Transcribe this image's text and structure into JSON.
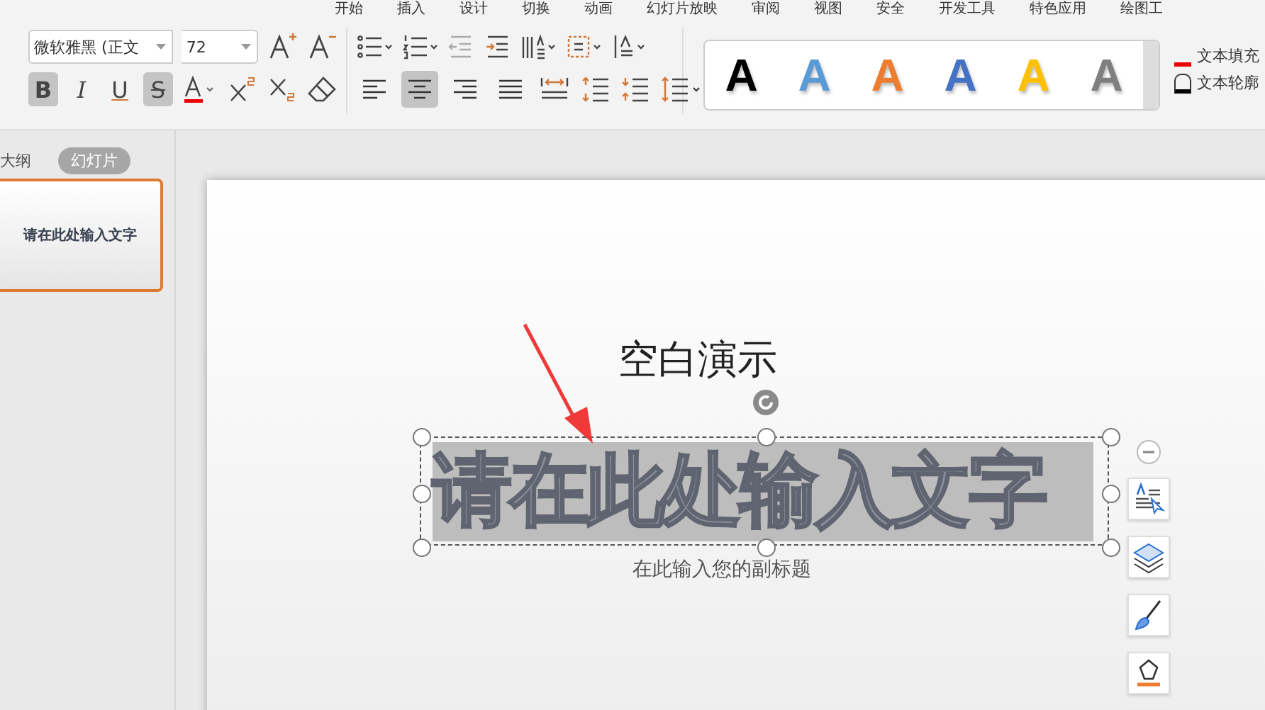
{
  "menu_tabs": [
    {
      "label": "开始",
      "selected": false
    },
    {
      "label": "插入",
      "selected": false
    },
    {
      "label": "设计",
      "selected": false
    },
    {
      "label": "切换",
      "selected": false
    },
    {
      "label": "动画",
      "selected": false
    },
    {
      "label": "幻灯片放映",
      "selected": false
    },
    {
      "label": "审阅",
      "selected": false
    },
    {
      "label": "视图",
      "selected": false
    },
    {
      "label": "安全",
      "selected": false
    },
    {
      "label": "开发工具",
      "selected": false
    },
    {
      "label": "特色应用",
      "selected": false
    },
    {
      "label": "绘图工",
      "selected": false
    }
  ],
  "font": {
    "family": "微软雅黑 (正文",
    "size": "72"
  },
  "format_buttons": [
    {
      "kind": "bold",
      "label": "B",
      "selected": true
    },
    {
      "kind": "italic",
      "label": "I",
      "selected": false
    },
    {
      "kind": "underline",
      "label": "U",
      "selected": false
    },
    {
      "kind": "strike",
      "label": "S",
      "selected": true
    }
  ],
  "align_buttons": [
    {
      "kind": "left",
      "selected": false
    },
    {
      "kind": "center",
      "selected": true
    },
    {
      "kind": "right",
      "selected": false
    },
    {
      "kind": "justify",
      "selected": false
    }
  ],
  "text_styles": [
    {
      "label": "A",
      "color": "#000000"
    },
    {
      "label": "A",
      "color": "#5b9bd5"
    },
    {
      "label": "A",
      "color": "#ed7d31"
    },
    {
      "label": "A",
      "color": "#4472c4"
    },
    {
      "label": "A",
      "color": "#ffc000"
    },
    {
      "label": "A",
      "color": "#7f7f7f"
    }
  ],
  "text_fill": "文本填充",
  "text_outline": "文本轮廓",
  "panel_tabs": [
    {
      "label": "大纲",
      "selected": false
    },
    {
      "label": "幻灯片",
      "selected": true
    }
  ],
  "thumbnail": {
    "text": "请在此处输入文字",
    "selected": true
  },
  "slide": {
    "title": "空白演示",
    "subtitle": "在此输入您的副标题",
    "wordart": "请在此处输入文字"
  }
}
